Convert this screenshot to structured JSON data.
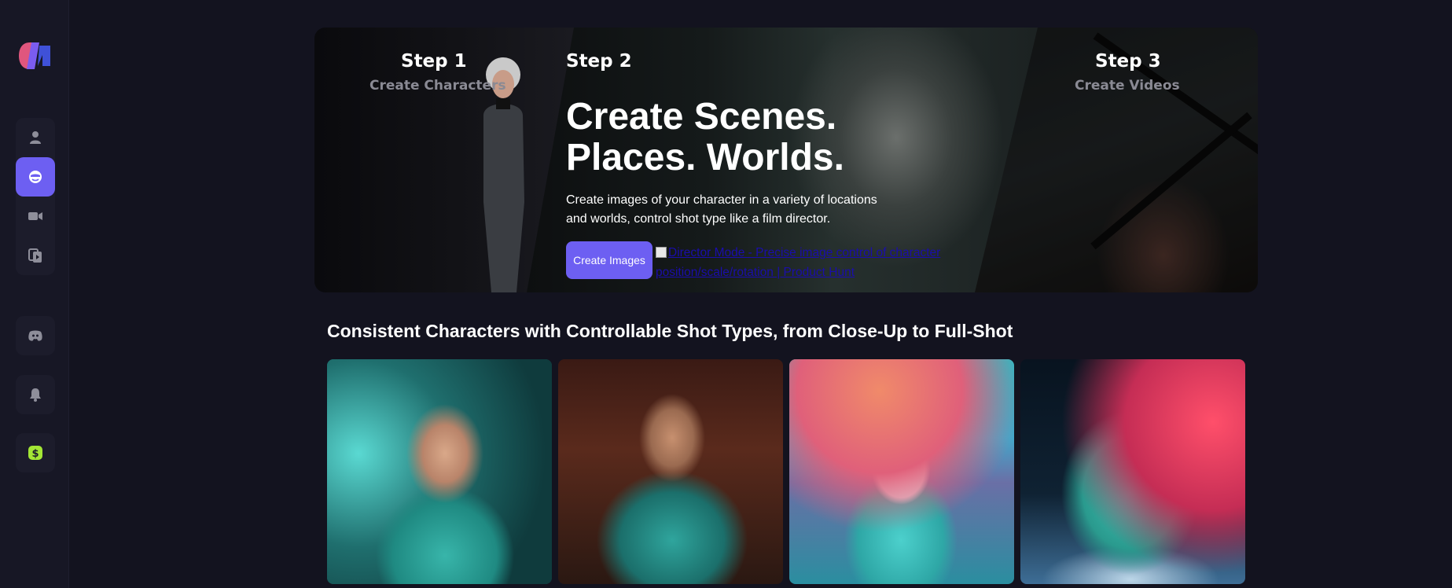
{
  "sidebar": {
    "logo": "app-logo",
    "nav_items": [
      {
        "name": "characters",
        "icon": "person-icon",
        "active": false
      },
      {
        "name": "images",
        "icon": "face-icon",
        "active": true
      },
      {
        "name": "videos",
        "icon": "video-camera-icon",
        "active": false
      },
      {
        "name": "library",
        "icon": "copy-media-icon",
        "active": false
      }
    ],
    "extras": [
      {
        "name": "discord",
        "icon": "discord-icon"
      },
      {
        "name": "notifications",
        "icon": "bell-icon"
      },
      {
        "name": "billing",
        "icon": "dollar-icon"
      }
    ]
  },
  "hero": {
    "step1": {
      "title": "Step 1",
      "subtitle": "Create Characters"
    },
    "step2": {
      "title": "Step 2"
    },
    "step3": {
      "title": "Step 3",
      "subtitle": "Create Videos"
    },
    "headline_line1": "Create Scenes.",
    "headline_line2": "Places. Worlds.",
    "description": "Create images of your character in a variety of locations and worlds, control shot type like a film director.",
    "cta_label": "Create Images",
    "product_hunt_alt": "Director Mode - Precise image control of character position/scale/rotation | Product Hunt"
  },
  "section": {
    "title": "Consistent Characters with Controllable Shot Types, from Close-Up to Full-Shot"
  },
  "colors": {
    "background": "#13131f",
    "sidebar": "#171725",
    "accent": "#6d5ff2",
    "link": "#1a0dab",
    "muted": "#8a8a94"
  }
}
